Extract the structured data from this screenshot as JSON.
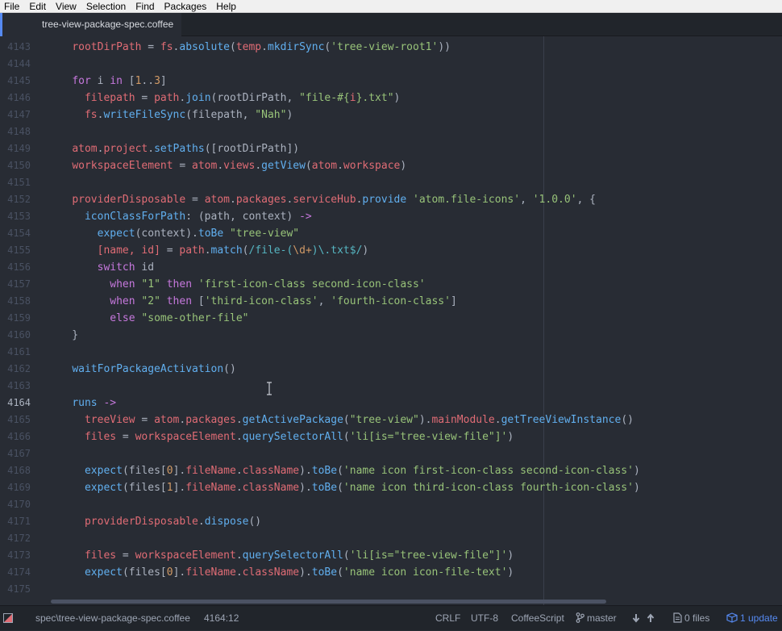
{
  "menu": [
    "File",
    "Edit",
    "View",
    "Selection",
    "Find",
    "Packages",
    "Help"
  ],
  "tab": {
    "title": "tree-view-package-spec.coffee"
  },
  "editor": {
    "current_line": "4164",
    "lines": [
      {
        "num": "4143",
        "tokens": [
          [
            "    ",
            "plain"
          ],
          [
            "rootDirPath",
            "red"
          ],
          [
            " = ",
            "plain"
          ],
          [
            "fs",
            "red"
          ],
          [
            ".",
            "plain"
          ],
          [
            "absolute",
            "blue"
          ],
          [
            "(",
            "plain"
          ],
          [
            "temp",
            "red"
          ],
          [
            ".",
            "plain"
          ],
          [
            "mkdirSync",
            "blue"
          ],
          [
            "(",
            "plain"
          ],
          [
            "'tree-view-root1'",
            "green"
          ],
          [
            "))",
            "plain"
          ]
        ]
      },
      {
        "num": "4144",
        "tokens": []
      },
      {
        "num": "4145",
        "tokens": [
          [
            "    ",
            "plain"
          ],
          [
            "for",
            "purple"
          ],
          [
            " i ",
            "plain"
          ],
          [
            "in",
            "purple"
          ],
          [
            " [",
            "plain"
          ],
          [
            "1",
            "orange"
          ],
          [
            "..",
            "plain"
          ],
          [
            "3",
            "orange"
          ],
          [
            "]",
            "plain"
          ]
        ]
      },
      {
        "num": "4146",
        "tokens": [
          [
            "      ",
            "plain"
          ],
          [
            "filepath",
            "red"
          ],
          [
            " = ",
            "plain"
          ],
          [
            "path",
            "red"
          ],
          [
            ".",
            "plain"
          ],
          [
            "join",
            "blue"
          ],
          [
            "(rootDirPath, ",
            "plain"
          ],
          [
            "\"file-#{",
            "green"
          ],
          [
            "i",
            "red"
          ],
          [
            "}.txt\"",
            "green"
          ],
          [
            ")",
            "plain"
          ]
        ]
      },
      {
        "num": "4147",
        "tokens": [
          [
            "      ",
            "plain"
          ],
          [
            "fs",
            "red"
          ],
          [
            ".",
            "plain"
          ],
          [
            "writeFileSync",
            "blue"
          ],
          [
            "(filepath, ",
            "plain"
          ],
          [
            "\"Nah\"",
            "green"
          ],
          [
            ")",
            "plain"
          ]
        ]
      },
      {
        "num": "4148",
        "tokens": []
      },
      {
        "num": "4149",
        "tokens": [
          [
            "    ",
            "plain"
          ],
          [
            "atom",
            "red"
          ],
          [
            ".",
            "plain"
          ],
          [
            "project",
            "red"
          ],
          [
            ".",
            "plain"
          ],
          [
            "setPaths",
            "blue"
          ],
          [
            "([rootDirPath])",
            "plain"
          ]
        ]
      },
      {
        "num": "4150",
        "tokens": [
          [
            "    ",
            "plain"
          ],
          [
            "workspaceElement",
            "red"
          ],
          [
            " = ",
            "plain"
          ],
          [
            "atom",
            "red"
          ],
          [
            ".",
            "plain"
          ],
          [
            "views",
            "red"
          ],
          [
            ".",
            "plain"
          ],
          [
            "getView",
            "blue"
          ],
          [
            "(",
            "plain"
          ],
          [
            "atom",
            "red"
          ],
          [
            ".",
            "plain"
          ],
          [
            "workspace",
            "red"
          ],
          [
            ")",
            "plain"
          ]
        ]
      },
      {
        "num": "4151",
        "tokens": []
      },
      {
        "num": "4152",
        "tokens": [
          [
            "    ",
            "plain"
          ],
          [
            "providerDisposable",
            "red"
          ],
          [
            " = ",
            "plain"
          ],
          [
            "atom",
            "red"
          ],
          [
            ".",
            "plain"
          ],
          [
            "packages",
            "red"
          ],
          [
            ".",
            "plain"
          ],
          [
            "serviceHub",
            "red"
          ],
          [
            ".",
            "plain"
          ],
          [
            "provide",
            "blue"
          ],
          [
            " ",
            "plain"
          ],
          [
            "'atom.file-icons'",
            "green"
          ],
          [
            ", ",
            "plain"
          ],
          [
            "'1.0.0'",
            "green"
          ],
          [
            ", {",
            "plain"
          ]
        ]
      },
      {
        "num": "4153",
        "tokens": [
          [
            "      ",
            "plain"
          ],
          [
            "iconClassForPath",
            "blue"
          ],
          [
            ": (path, context) ",
            "plain"
          ],
          [
            "->",
            "purple"
          ]
        ]
      },
      {
        "num": "4154",
        "tokens": [
          [
            "        ",
            "plain"
          ],
          [
            "expect",
            "blue"
          ],
          [
            "(context).",
            "plain"
          ],
          [
            "toBe",
            "blue"
          ],
          [
            " ",
            "plain"
          ],
          [
            "\"tree-view\"",
            "green"
          ]
        ]
      },
      {
        "num": "4155",
        "tokens": [
          [
            "        ",
            "plain"
          ],
          [
            "[name, id]",
            "red"
          ],
          [
            " = ",
            "plain"
          ],
          [
            "path",
            "red"
          ],
          [
            ".",
            "plain"
          ],
          [
            "match",
            "blue"
          ],
          [
            "(",
            "plain"
          ],
          [
            "/file-(",
            "cyan"
          ],
          [
            "\\d+",
            "orange"
          ],
          [
            ")\\.txt$/",
            "cyan"
          ],
          [
            ")",
            "plain"
          ]
        ]
      },
      {
        "num": "4156",
        "tokens": [
          [
            "        ",
            "plain"
          ],
          [
            "switch",
            "purple"
          ],
          [
            " id",
            "plain"
          ]
        ]
      },
      {
        "num": "4157",
        "tokens": [
          [
            "          ",
            "plain"
          ],
          [
            "when",
            "purple"
          ],
          [
            " ",
            "plain"
          ],
          [
            "\"1\"",
            "green"
          ],
          [
            " ",
            "plain"
          ],
          [
            "then",
            "purple"
          ],
          [
            " ",
            "plain"
          ],
          [
            "'first-icon-class second-icon-class'",
            "green"
          ]
        ]
      },
      {
        "num": "4158",
        "tokens": [
          [
            "          ",
            "plain"
          ],
          [
            "when",
            "purple"
          ],
          [
            " ",
            "plain"
          ],
          [
            "\"2\"",
            "green"
          ],
          [
            " ",
            "plain"
          ],
          [
            "then",
            "purple"
          ],
          [
            " [",
            "plain"
          ],
          [
            "'third-icon-class'",
            "green"
          ],
          [
            ", ",
            "plain"
          ],
          [
            "'fourth-icon-class'",
            "green"
          ],
          [
            "]",
            "plain"
          ]
        ]
      },
      {
        "num": "4159",
        "tokens": [
          [
            "          ",
            "plain"
          ],
          [
            "else",
            "purple"
          ],
          [
            " ",
            "plain"
          ],
          [
            "\"some-other-file\"",
            "green"
          ]
        ]
      },
      {
        "num": "4160",
        "tokens": [
          [
            "    }",
            "plain"
          ]
        ]
      },
      {
        "num": "4161",
        "tokens": []
      },
      {
        "num": "4162",
        "tokens": [
          [
            "    ",
            "plain"
          ],
          [
            "waitForPackageActivation",
            "blue"
          ],
          [
            "()",
            "plain"
          ]
        ]
      },
      {
        "num": "4163",
        "tokens": []
      },
      {
        "num": "4164",
        "tokens": [
          [
            "    ",
            "plain"
          ],
          [
            "runs",
            "blue"
          ],
          [
            " ",
            "plain"
          ],
          [
            "->",
            "purple"
          ]
        ]
      },
      {
        "num": "4165",
        "tokens": [
          [
            "      ",
            "plain"
          ],
          [
            "treeView",
            "red"
          ],
          [
            " = ",
            "plain"
          ],
          [
            "atom",
            "red"
          ],
          [
            ".",
            "plain"
          ],
          [
            "packages",
            "red"
          ],
          [
            ".",
            "plain"
          ],
          [
            "getActivePackage",
            "blue"
          ],
          [
            "(",
            "plain"
          ],
          [
            "\"tree-view\"",
            "green"
          ],
          [
            ").",
            "plain"
          ],
          [
            "mainModule",
            "red"
          ],
          [
            ".",
            "plain"
          ],
          [
            "getTreeViewInstance",
            "blue"
          ],
          [
            "()",
            "plain"
          ]
        ]
      },
      {
        "num": "4166",
        "tokens": [
          [
            "      ",
            "plain"
          ],
          [
            "files",
            "red"
          ],
          [
            " = ",
            "plain"
          ],
          [
            "workspaceElement",
            "red"
          ],
          [
            ".",
            "plain"
          ],
          [
            "querySelectorAll",
            "blue"
          ],
          [
            "(",
            "plain"
          ],
          [
            "'li[is=\"tree-view-file\"]'",
            "green"
          ],
          [
            ")",
            "plain"
          ]
        ]
      },
      {
        "num": "4167",
        "tokens": []
      },
      {
        "num": "4168",
        "tokens": [
          [
            "      ",
            "plain"
          ],
          [
            "expect",
            "blue"
          ],
          [
            "(files[",
            "plain"
          ],
          [
            "0",
            "orange"
          ],
          [
            "].",
            "plain"
          ],
          [
            "fileName",
            "red"
          ],
          [
            ".",
            "plain"
          ],
          [
            "className",
            "red"
          ],
          [
            ").",
            "plain"
          ],
          [
            "toBe",
            "blue"
          ],
          [
            "(",
            "plain"
          ],
          [
            "'name icon first-icon-class second-icon-class'",
            "green"
          ],
          [
            ")",
            "plain"
          ]
        ]
      },
      {
        "num": "4169",
        "tokens": [
          [
            "      ",
            "plain"
          ],
          [
            "expect",
            "blue"
          ],
          [
            "(files[",
            "plain"
          ],
          [
            "1",
            "orange"
          ],
          [
            "].",
            "plain"
          ],
          [
            "fileName",
            "red"
          ],
          [
            ".",
            "plain"
          ],
          [
            "className",
            "red"
          ],
          [
            ").",
            "plain"
          ],
          [
            "toBe",
            "blue"
          ],
          [
            "(",
            "plain"
          ],
          [
            "'name icon third-icon-class fourth-icon-class'",
            "green"
          ],
          [
            ")",
            "plain"
          ]
        ]
      },
      {
        "num": "4170",
        "tokens": []
      },
      {
        "num": "4171",
        "tokens": [
          [
            "      ",
            "plain"
          ],
          [
            "providerDisposable",
            "red"
          ],
          [
            ".",
            "plain"
          ],
          [
            "dispose",
            "blue"
          ],
          [
            "()",
            "plain"
          ]
        ]
      },
      {
        "num": "4172",
        "tokens": []
      },
      {
        "num": "4173",
        "tokens": [
          [
            "      ",
            "plain"
          ],
          [
            "files",
            "red"
          ],
          [
            " = ",
            "plain"
          ],
          [
            "workspaceElement",
            "red"
          ],
          [
            ".",
            "plain"
          ],
          [
            "querySelectorAll",
            "blue"
          ],
          [
            "(",
            "plain"
          ],
          [
            "'li[is=\"tree-view-file\"]'",
            "green"
          ],
          [
            ")",
            "plain"
          ]
        ]
      },
      {
        "num": "4174",
        "tokens": [
          [
            "      ",
            "plain"
          ],
          [
            "expect",
            "blue"
          ],
          [
            "(files[",
            "plain"
          ],
          [
            "0",
            "orange"
          ],
          [
            "].",
            "plain"
          ],
          [
            "fileName",
            "red"
          ],
          [
            ".",
            "plain"
          ],
          [
            "className",
            "red"
          ],
          [
            ").",
            "plain"
          ],
          [
            "toBe",
            "blue"
          ],
          [
            "(",
            "plain"
          ],
          [
            "'name icon icon-file-text'",
            "green"
          ],
          [
            ")",
            "plain"
          ]
        ]
      },
      {
        "num": "4175",
        "tokens": []
      }
    ]
  },
  "status": {
    "file_path": "spec\\tree-view-package-spec.coffee",
    "cursor_pos": "4164:12",
    "line_ending": "CRLF",
    "encoding": "UTF-8",
    "grammar": "CoffeeScript",
    "branch": "master",
    "files": "0 files",
    "updates": "1 update"
  },
  "colors": {
    "red": "#e06c75",
    "blue": "#61afef",
    "purple": "#c678dd",
    "green": "#98c379",
    "orange": "#d19a66",
    "cyan": "#56b6c2",
    "accent": "#568af2"
  }
}
